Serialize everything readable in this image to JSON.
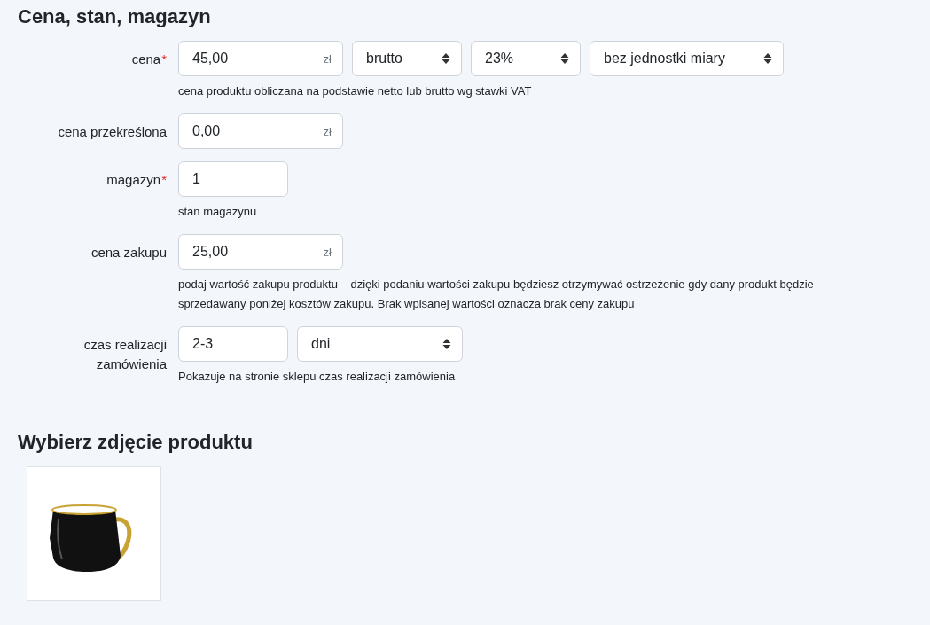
{
  "sections": [
    {
      "kind": "form",
      "title": "Cena, stan, magazyn",
      "rows": [
        {
          "label": "cena",
          "required_mark": "*",
          "fields": [
            {
              "kind": "input",
              "value": "45,00",
              "suffix": "zł"
            },
            {
              "kind": "select",
              "value": "brutto"
            },
            {
              "kind": "select",
              "value": "23%"
            },
            {
              "kind": "select",
              "value": "bez jednostki miary"
            }
          ],
          "hint": "cena produktu obliczana na podstawie netto lub brutto wg stawki VAT"
        },
        {
          "label": "cena przekreślona",
          "fields": [
            {
              "kind": "input",
              "value": "0,00",
              "suffix": "zł"
            }
          ]
        },
        {
          "label": "magazyn",
          "required_mark": "*",
          "fields": [
            {
              "kind": "input",
              "value": "1"
            }
          ],
          "hint": "stan magazynu"
        },
        {
          "label": "cena zakupu",
          "fields": [
            {
              "kind": "input",
              "value": "25,00",
              "suffix": "zł"
            }
          ],
          "hint": "podaj wartość zakupu produktu – dzięki podaniu wartości zakupu będziesz otrzymywać ostrzeżenie gdy dany produkt będzie sprzedawany poniżej kosztów zakupu. Brak wpisanej wartości oznacza brak ceny zakupu"
        },
        {
          "label": "czas realizacji zamówienia",
          "fields": [
            {
              "kind": "input",
              "value": "2-3"
            },
            {
              "kind": "select",
              "value": "dni"
            }
          ],
          "hint": "Pokazuje na stronie sklepu czas realizacji zamówienia"
        }
      ]
    },
    {
      "kind": "gallery",
      "title": "Wybierz zdjęcie produktu"
    }
  ]
}
